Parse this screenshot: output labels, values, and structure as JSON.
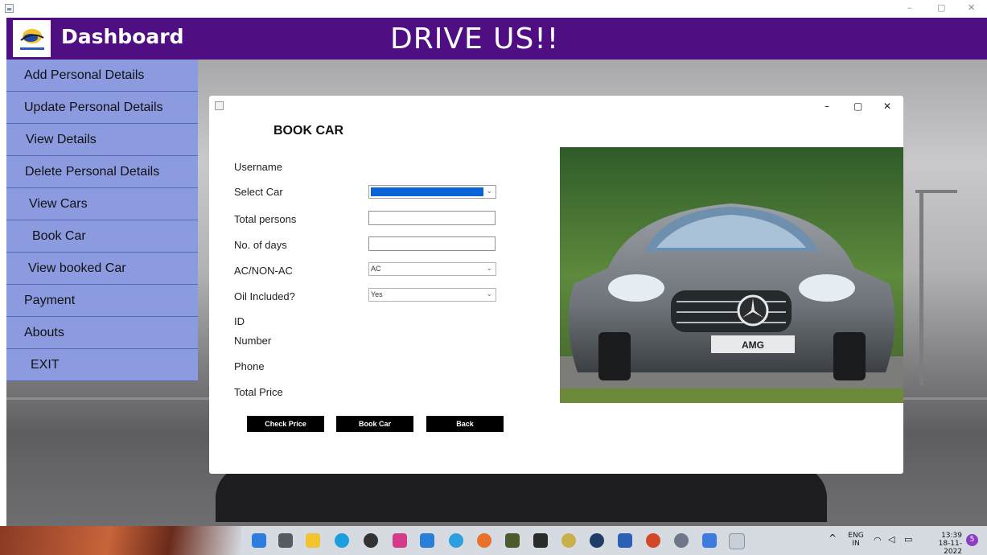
{
  "header": {
    "title": "Dashboard",
    "app_title": "DRIVE US!!"
  },
  "sidebar": {
    "items": [
      {
        "label": "Add Personal Details"
      },
      {
        "label": "Update Personal Details"
      },
      {
        "label": "View Details"
      },
      {
        "label": "Delete Personal Details"
      },
      {
        "label": "View Cars"
      },
      {
        "label": "Book Car"
      },
      {
        "label": "View booked Car"
      },
      {
        "label": "Payment"
      },
      {
        "label": "Abouts"
      },
      {
        "label": "EXIT"
      }
    ]
  },
  "dialog": {
    "title": "BOOK CAR",
    "labels": {
      "username": "Username",
      "select_car": "Select Car",
      "total_persons": "Total persons",
      "days": "No. of days",
      "ac": "AC/NON-AC",
      "oil": "Oil Included?",
      "id": "ID",
      "number": "Number",
      "phone": "Phone",
      "total_price": "Total Price"
    },
    "fields": {
      "select_car": "",
      "total_persons": "",
      "days": "",
      "ac": "AC",
      "oil": "Yes"
    },
    "buttons": {
      "check_price": "Check Price",
      "book_car": "Book Car",
      "back": "Back"
    },
    "car_badge": "AMG"
  },
  "window_controls": {
    "minimize": "–",
    "maximize": "▢",
    "close": "✕"
  },
  "taskbar": {
    "lang_top": "ENG",
    "lang_bottom": "IN",
    "time": "13:39",
    "date": "18-11-2022",
    "notif": "5"
  },
  "colors": {
    "header": "#4f0f83",
    "sidebar": "#8c9ae0",
    "button": "#000000",
    "selection": "#0a64d8"
  }
}
